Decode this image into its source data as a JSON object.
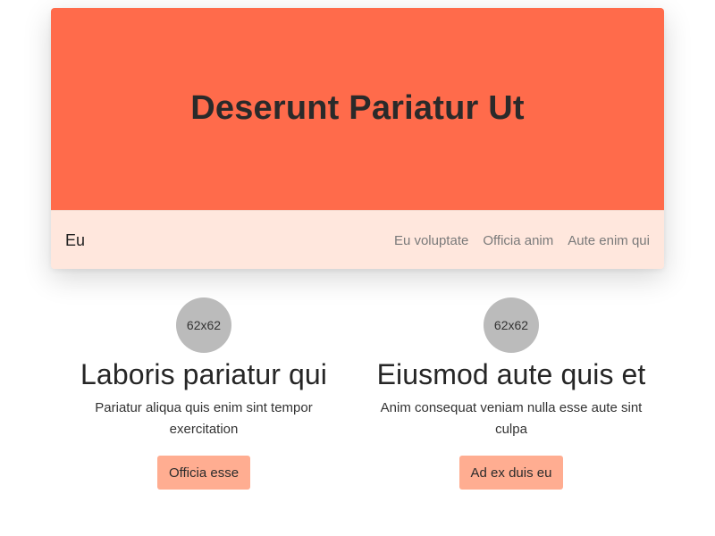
{
  "hero": {
    "title": "Deserunt Pariatur Ut"
  },
  "navbar": {
    "brand": "Eu",
    "links": [
      "Eu voluptate",
      "Officia anim",
      "Aute enim qui"
    ]
  },
  "features": [
    {
      "image_label": "62x62",
      "title": "Laboris pariatur qui",
      "description": "Pariatur aliqua quis enim sint tempor exercitation",
      "button_label": "Officia esse"
    },
    {
      "image_label": "62x62",
      "title": "Eiusmod aute quis et",
      "description": "Anim consequat veniam nulla esse aute sint culpa",
      "button_label": "Ad ex duis eu"
    }
  ],
  "colors": {
    "hero_bg": "#ff6b4b",
    "navbar_bg": "#ffe7dd",
    "button_bg": "#ffad91",
    "placeholder_bg": "#bbbbbb"
  }
}
